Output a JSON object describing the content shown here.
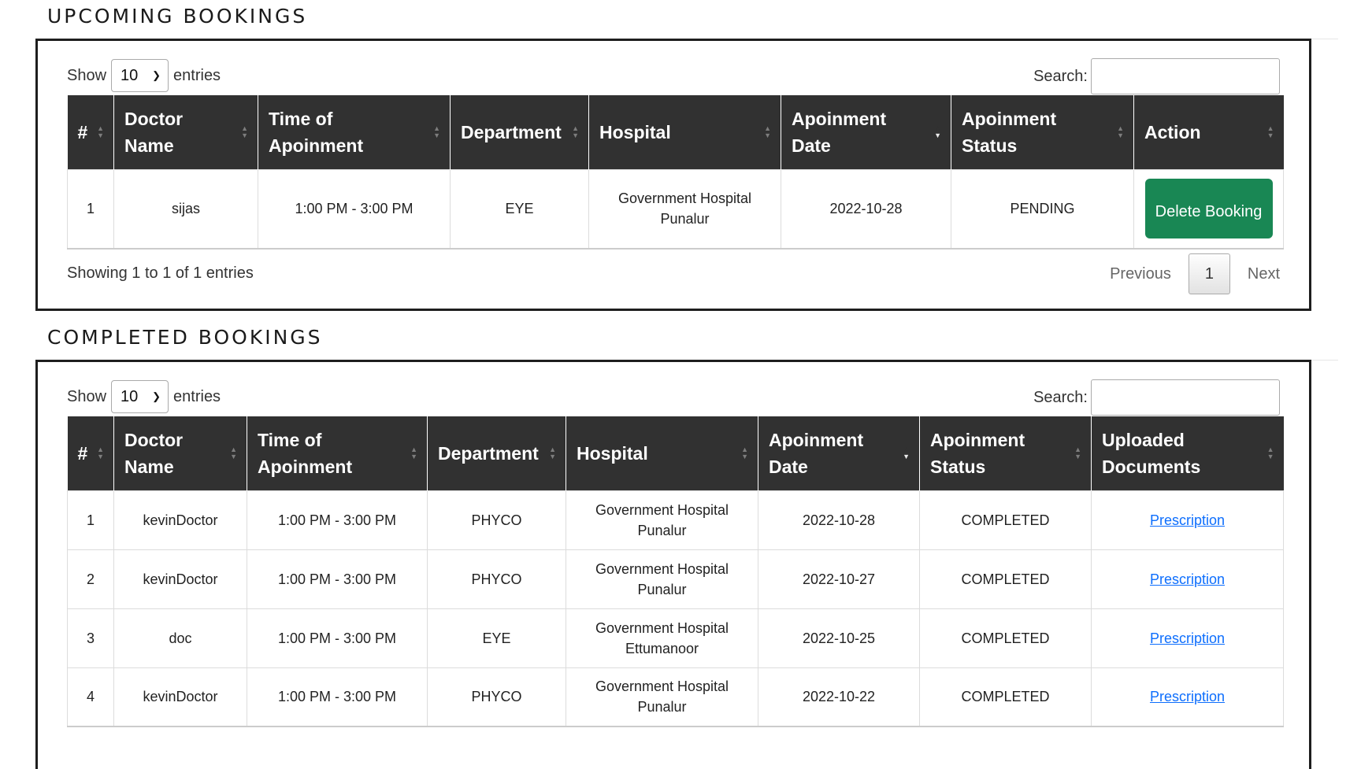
{
  "upcoming": {
    "title": "UPCOMING BOOKINGS",
    "show_label": "Show",
    "entries_label": "entries",
    "page_length": "10",
    "search_label": "Search:",
    "columns": [
      "#",
      "Doctor Name",
      "Time of Apoinment",
      "Department",
      "Hospital",
      "Apoinment Date",
      "Apoinment Status",
      "Action"
    ],
    "rows": [
      {
        "num": "1",
        "doctor": "sijas",
        "time": "1:00 PM - 3:00 PM",
        "department": "EYE",
        "hospital": "Government Hospital Punalur",
        "date": "2022-10-28",
        "status": "PENDING",
        "action": "Delete Booking"
      }
    ],
    "info": "Showing 1 to 1 of 1 entries",
    "pagination": {
      "previous": "Previous",
      "page": "1",
      "next": "Next"
    }
  },
  "completed": {
    "title": "COMPLETED BOOKINGS",
    "show_label": "Show",
    "entries_label": "entries",
    "page_length": "10",
    "search_label": "Search:",
    "columns": [
      "#",
      "Doctor Name",
      "Time of Apoinment",
      "Department",
      "Hospital",
      "Apoinment Date",
      "Apoinment Status",
      "Uploaded Documents"
    ],
    "rows": [
      {
        "num": "1",
        "doctor": "kevinDoctor",
        "time": "1:00 PM - 3:00 PM",
        "department": "PHYCO",
        "hospital": "Government Hospital Punalur",
        "date": "2022-10-28",
        "status": "COMPLETED",
        "document": "Prescription"
      },
      {
        "num": "2",
        "doctor": "kevinDoctor",
        "time": "1:00 PM - 3:00 PM",
        "department": "PHYCO",
        "hospital": "Government Hospital Punalur",
        "date": "2022-10-27",
        "status": "COMPLETED",
        "document": "Prescription"
      },
      {
        "num": "3",
        "doctor": "doc",
        "time": "1:00 PM - 3:00 PM",
        "department": "EYE",
        "hospital": "Government Hospital Ettumanoor",
        "date": "2022-10-25",
        "status": "COMPLETED",
        "document": "Prescription"
      },
      {
        "num": "4",
        "doctor": "kevinDoctor",
        "time": "1:00 PM - 3:00 PM",
        "department": "PHYCO",
        "hospital": "Government Hospital Punalur",
        "date": "2022-10-22",
        "status": "COMPLETED",
        "document": "Prescription"
      }
    ]
  },
  "theme": {
    "header_bg": "#313131",
    "button_green": "#198754",
    "link_blue": "#0d6efd"
  },
  "icons": {
    "sort": "sort-both-icon",
    "sort_desc": "sort-desc-icon",
    "select": "chevron-down-icon"
  }
}
